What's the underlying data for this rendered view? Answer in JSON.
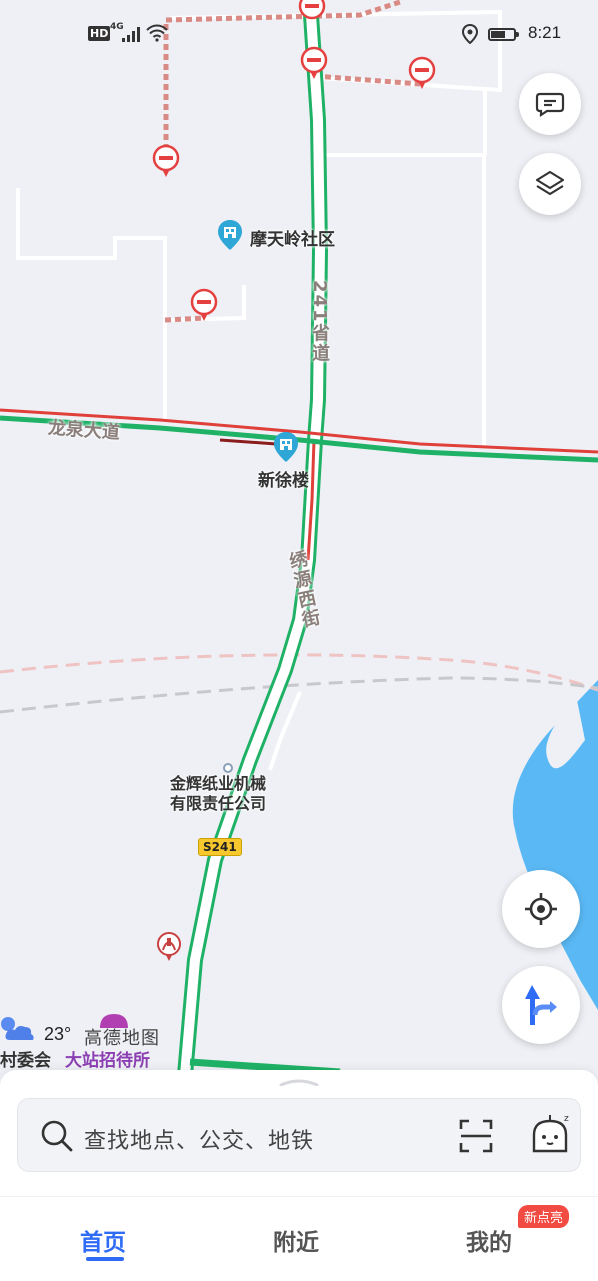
{
  "status_bar": {
    "hd": "HD",
    "network": "4G",
    "time": "8:21",
    "battery_level": 0.65
  },
  "map": {
    "poi_community": "摩天岭社区",
    "poi_building": "新徐楼",
    "road_longquan": "龙泉大道",
    "road_provincial": "241省道",
    "road_xiuyuan": "绣源西街",
    "company": "金辉纸业机械有限责任公司",
    "company_line1": "金辉纸业机械",
    "company_line2": "有限责任公司",
    "route_badge": "S241",
    "village_committee": "村委会",
    "hotel": "大站招待所"
  },
  "weather": {
    "temperature": "23°",
    "brand": "高德地图"
  },
  "search": {
    "placeholder": "查找地点、公交、地铁"
  },
  "tabs": {
    "home": "首页",
    "nearby": "附近",
    "mine": "我的",
    "mine_badge": "新点亮"
  },
  "colors": {
    "accent": "#2e6cf5",
    "road_green": "#1fb266",
    "road_red": "#e0403a",
    "water": "#5ab9f5"
  }
}
